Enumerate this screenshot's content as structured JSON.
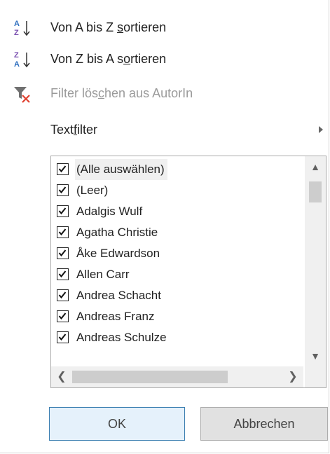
{
  "menu": {
    "sort_az": {
      "pre": "Von A bis Z ",
      "u": "s",
      "post": "ortieren"
    },
    "sort_za": {
      "pre": "Von Z bis A s",
      "u": "o",
      "post": "rtieren"
    },
    "clear_filter": {
      "pre": "Filter lös",
      "u": "c",
      "post": "hen aus AutorIn"
    },
    "text_filter": {
      "pre": "Text",
      "u": "f",
      "post": "ilter"
    }
  },
  "list": {
    "items": [
      {
        "label": "(Alle auswählen)",
        "checked": true
      },
      {
        "label": "(Leer)",
        "checked": true
      },
      {
        "label": "Adalgis Wulf",
        "checked": true
      },
      {
        "label": "Agatha Christie",
        "checked": true
      },
      {
        "label": "Åke Edwardson",
        "checked": true
      },
      {
        "label": "Allen Carr",
        "checked": true
      },
      {
        "label": "Andrea Schacht",
        "checked": true
      },
      {
        "label": "Andreas Franz",
        "checked": true
      },
      {
        "label": "Andreas Schulze",
        "checked": true
      }
    ]
  },
  "buttons": {
    "ok": "OK",
    "cancel": "Abbrechen"
  },
  "icons": {
    "sort_az": "sort-ascending-icon",
    "sort_za": "sort-descending-icon",
    "clear_filter": "clear-filter-icon"
  },
  "colors": {
    "accent": "#3c7fb1",
    "clear_x": "#e0402f",
    "az_blue": "#2f6fbf",
    "za_purple": "#7a4fb0"
  }
}
